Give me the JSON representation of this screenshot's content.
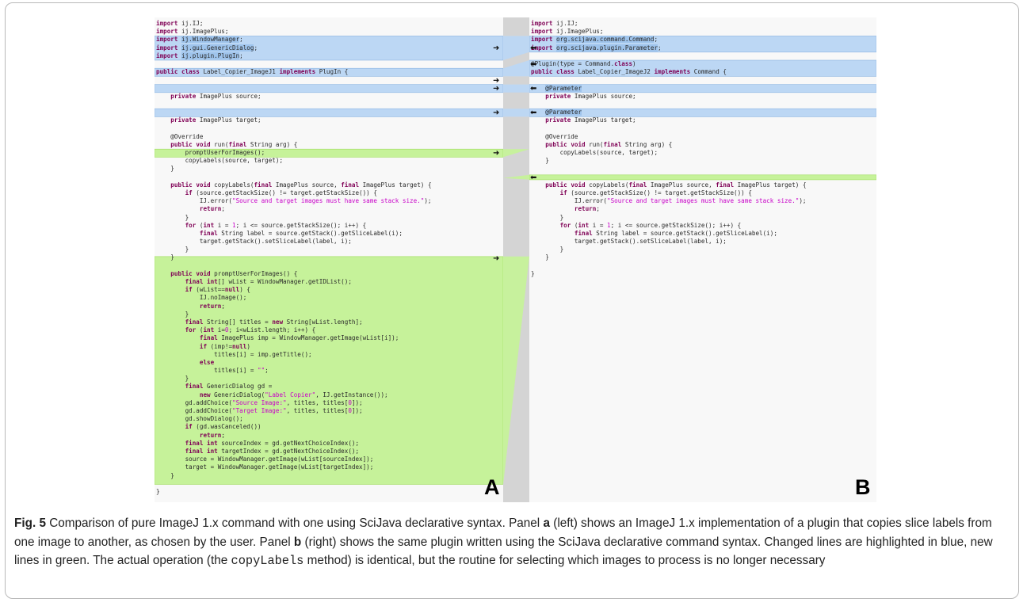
{
  "panels": {
    "a": {
      "letter": "A",
      "lines": [
        "import ij.IJ;",
        "import ij.ImagePlus;",
        "import ij.WindowManager;",
        "import ij.gui.GenericDialog;",
        "import ij.plugin.PlugIn;",
        "",
        "public class Label_Copier_ImageJ1 implements PlugIn {",
        "",
        "",
        "    private ImagePlus source;",
        "",
        "",
        "    private ImagePlus target;",
        "",
        "    @Override",
        "    public void run(final String arg) {",
        "        promptUserForImages();",
        "        copyLabels(source, target);",
        "    }",
        "",
        "    public void copyLabels(final ImagePlus source, final ImagePlus target) {",
        "        if (source.getStackSize() != target.getStackSize()) {",
        "            IJ.error(\"Source and target images must have same stack size.\");",
        "            return;",
        "        }",
        "        for (int i = 1; i <= source.getStackSize(); i++) {",
        "            final String label = source.getStack().getSliceLabel(i);",
        "            target.getStack().setSliceLabel(label, i);",
        "        }",
        "    }",
        "",
        "    public void promptUserForImages() {",
        "        final int[] wList = WindowManager.getIDList();",
        "        if (wList==null) {",
        "            IJ.noImage();",
        "            return;",
        "        }",
        "        final String[] titles = new String[wList.length];",
        "        for (int i=0; i<wList.length; i++) {",
        "            final ImagePlus imp = WindowManager.getImage(wList[i]);",
        "            if (imp!=null)",
        "                titles[i] = imp.getTitle();",
        "            else",
        "                titles[i] = \"\";",
        "        }",
        "        final GenericDialog gd =",
        "            new GenericDialog(\"Label Copier\", IJ.getInstance());",
        "        gd.addChoice(\"Source Image:\", titles, titles[0]);",
        "        gd.addChoice(\"Target Image:\", titles, titles[0]);",
        "        gd.showDialog();",
        "        if (gd.wasCanceled())",
        "            return;",
        "        final int sourceIndex = gd.getNextChoiceIndex();",
        "        final int targetIndex = gd.getNextChoiceIndex();",
        "        source = WindowManager.getImage(wList[sourceIndex]);",
        "        target = WindowManager.getImage(wList[targetIndex]);",
        "    }",
        "",
        "}"
      ]
    },
    "b": {
      "letter": "B",
      "lines": [
        "import ij.IJ;",
        "import ij.ImagePlus;",
        "import org.scijava.command.Command;",
        "import org.scijava.plugin.Parameter;",
        "",
        "@Plugin(type = Command.class)",
        "public class Label_Copier_ImageJ2 implements Command {",
        "",
        "    @Parameter",
        "    private ImagePlus source;",
        "",
        "    @Parameter",
        "    private ImagePlus target;",
        "",
        "    @Override",
        "    public void run(final String arg) {",
        "        copyLabels(source, target);",
        "    }",
        "",
        "",
        "    public void copyLabels(final ImagePlus source, final ImagePlus target) {",
        "        if (source.getStackSize() != target.getStackSize()) {",
        "            IJ.error(\"Source and target images must have same stack size.\");",
        "            return;",
        "        }",
        "        for (int i = 1; i <= source.getStackSize(); i++) {",
        "            final String label = source.getStack().getSliceLabel(i);",
        "            target.getStack().setSliceLabel(label, i);",
        "        }",
        "    }",
        "",
        "}"
      ]
    }
  },
  "arrows": {
    "right": "➜",
    "left": "⬅"
  },
  "caption": {
    "label": "Fig. 5",
    "t1": " Comparison of pure ImageJ 1.x command with one using SciJava declarative syntax. Panel ",
    "a": "a",
    "t2": " (left) shows an ImageJ 1.x implementation of a plugin that copies slice labels from one image to another, as chosen by the user. Panel ",
    "b": "b",
    "t3": " (right) shows the same plugin written using the SciJava declarative command syntax. Changed lines are highlighted in blue, new lines in green. The actual operation (the ",
    "code": "copyLabels",
    "t4": " method) is identical, but the routine for selecting which images to process is no longer necessary"
  },
  "colors": {
    "changed": "#bcd7f4",
    "changed_border": "#8db5e2",
    "added": "#c6f29a",
    "added_border": "#9fdc5c",
    "gutter": "#d4d4d4"
  }
}
